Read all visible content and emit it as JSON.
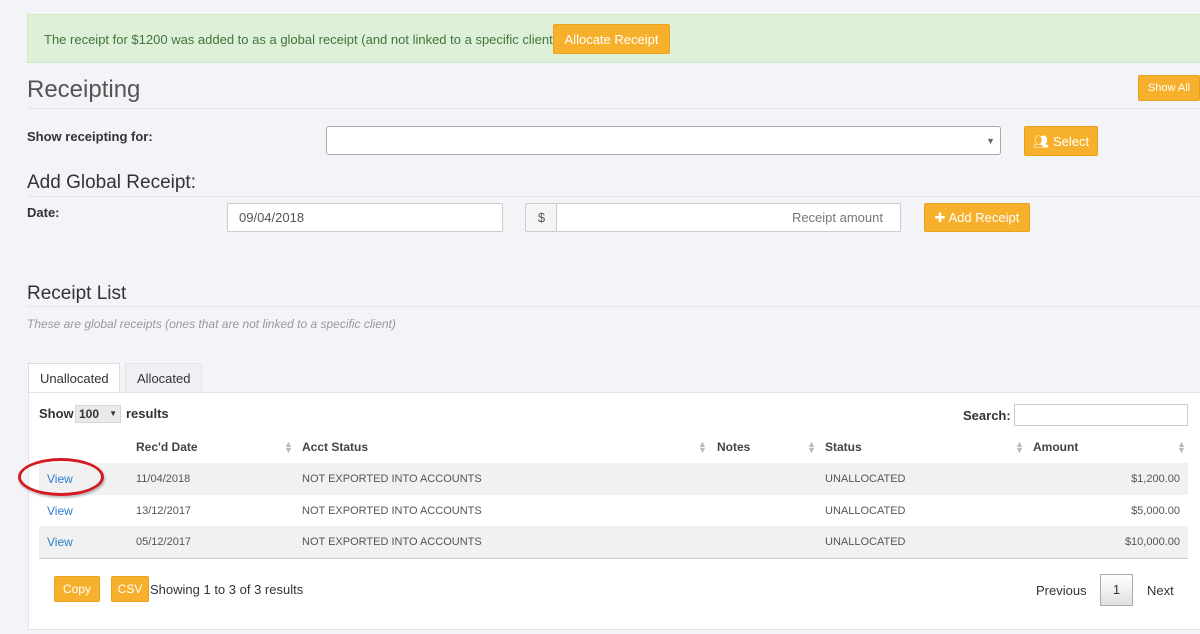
{
  "alert": {
    "message": "The receipt for $1200 was added to as a global receipt (and not linked to a specific client)",
    "action_label": "Allocate Receipt"
  },
  "page": {
    "title": "Receipting",
    "show_all_label": "Show All"
  },
  "receipting_for": {
    "label": "Show receipting for:",
    "value": "",
    "select_label": "Select"
  },
  "add_global": {
    "title": "Add Global Receipt:",
    "date_label": "Date:",
    "date_value": "09/04/2018",
    "currency": "$",
    "amount_placeholder": "Receipt amount",
    "add_label": "Add Receipt"
  },
  "receipt_list": {
    "title": "Receipt List",
    "subtitle": "These are global receipts (ones that are not linked to a specific client)",
    "tabs": [
      {
        "label": "Unallocated",
        "active": true
      },
      {
        "label": "Allocated",
        "active": false
      }
    ]
  },
  "table": {
    "show_label": "Show",
    "page_size": "100",
    "results_label": "results",
    "search_label": "Search:",
    "columns": [
      "Rec'd Date",
      "Acct Status",
      "Notes",
      "Status",
      "Amount"
    ],
    "rows": [
      {
        "link": "View",
        "date": "11/04/2018",
        "acct_status": "NOT EXPORTED INTO ACCOUNTS",
        "notes": "",
        "status": "UNALLOCATED",
        "amount": "$1,200.00"
      },
      {
        "link": "View",
        "date": "13/12/2017",
        "acct_status": "NOT EXPORTED INTO ACCOUNTS",
        "notes": "",
        "status": "UNALLOCATED",
        "amount": "$5,000.00"
      },
      {
        "link": "View",
        "date": "05/12/2017",
        "acct_status": "NOT EXPORTED INTO ACCOUNTS",
        "notes": "",
        "status": "UNALLOCATED",
        "amount": "$10,000.00"
      }
    ],
    "copy_label": "Copy",
    "csv_label": "CSV",
    "info": "Showing 1 to 3 of 3 results",
    "previous_label": "Previous",
    "current_page": "1",
    "next_label": "Next"
  },
  "colors": {
    "accent": "#f6b02c",
    "alert_bg": "#dff0d8",
    "link": "#2a7fc9",
    "annotation": "#d31b22"
  }
}
